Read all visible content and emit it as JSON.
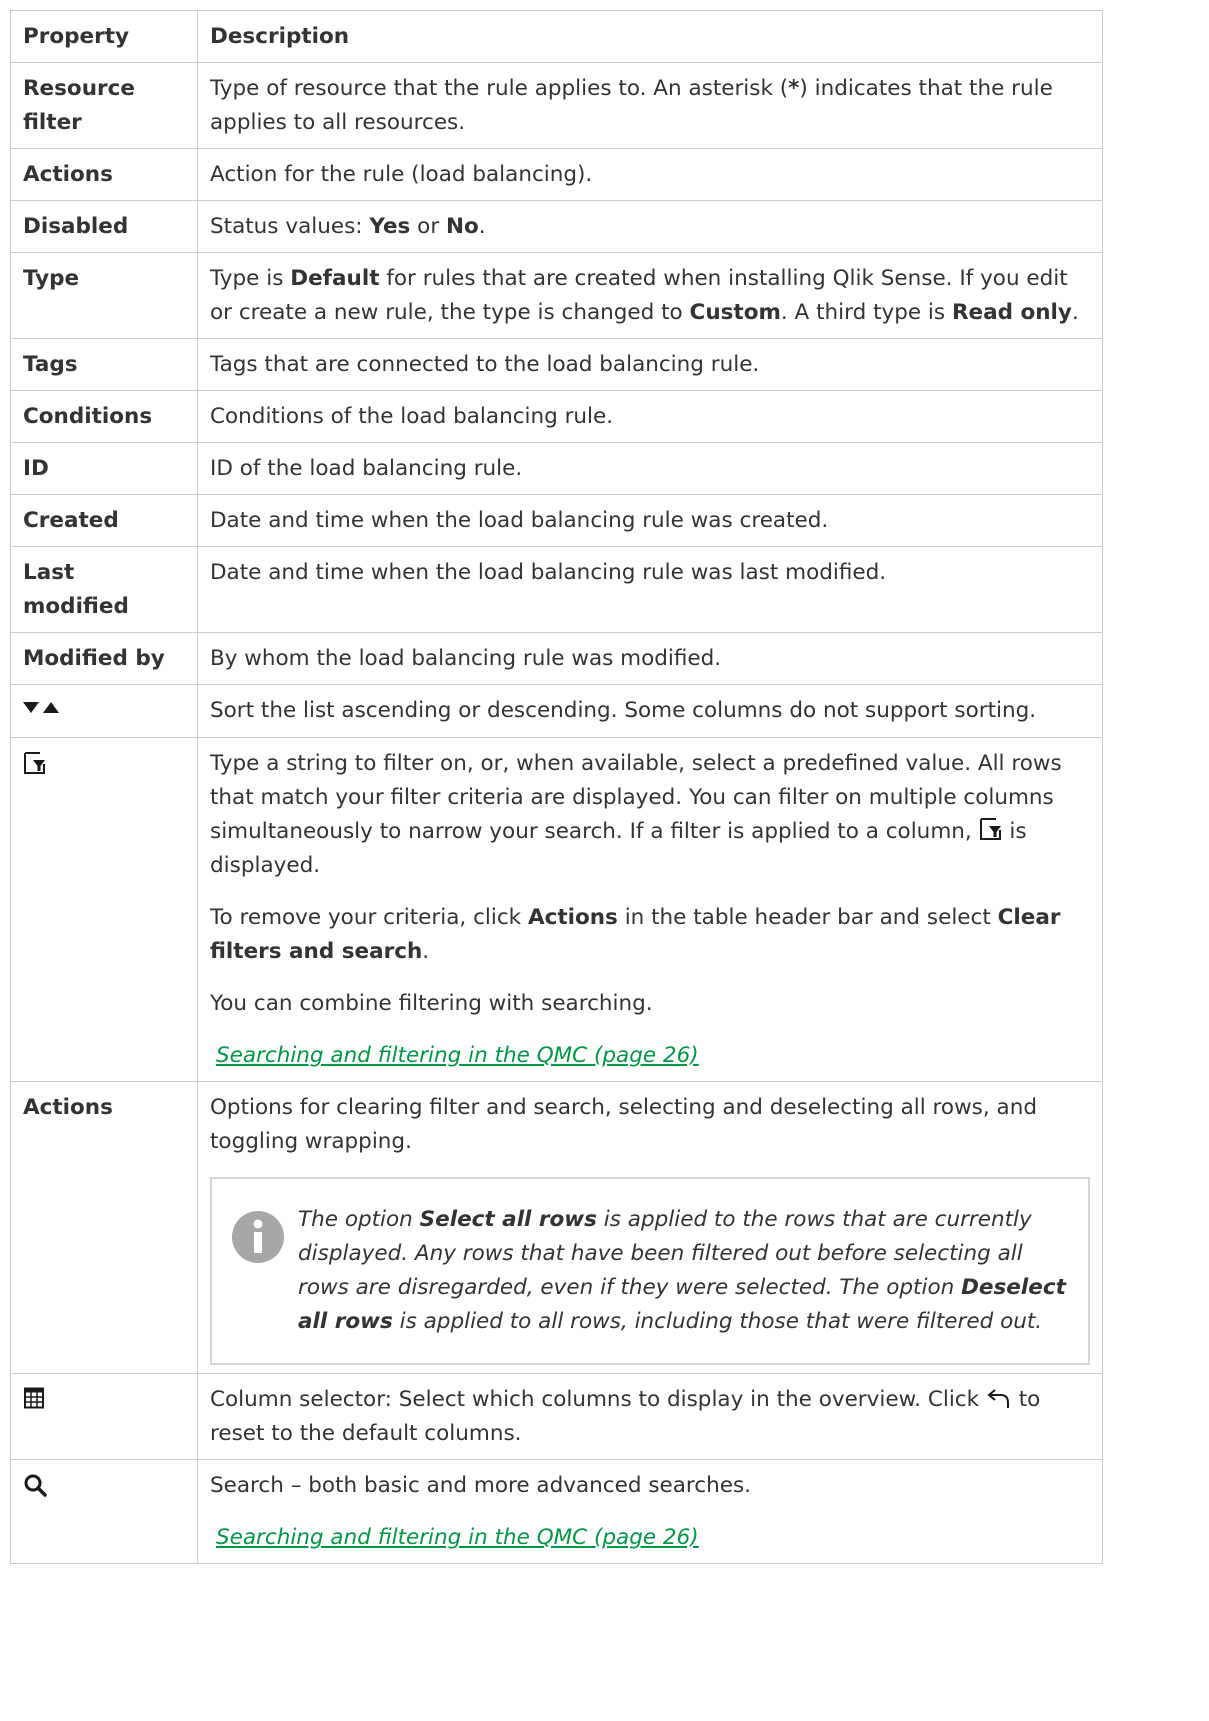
{
  "headers": {
    "property": "Property",
    "description": "Description"
  },
  "rows": {
    "resource_filter": {
      "property": "Resource filter",
      "d1": "Type of resource that the rule applies to. An asterisk (",
      "d2": "*",
      "d3": ") indicates that the rule applies to all resources."
    },
    "actions": {
      "property": "Actions",
      "description": "Action for the rule (load balancing)."
    },
    "disabled": {
      "property": "Disabled",
      "d1": "Status values: ",
      "d2": "Yes",
      "d3": " or ",
      "d4": "No",
      "d5": "."
    },
    "type": {
      "property": "Type",
      "d1": "Type is ",
      "d2": "Default",
      "d3": " for rules that are created when installing Qlik Sense. If you edit or create a new rule, the type is changed to ",
      "d4": "Custom",
      "d5": ". A third type is ",
      "d6": "Read only",
      "d7": "."
    },
    "tags": {
      "property": "Tags",
      "description": "Tags that are connected to the load balancing rule."
    },
    "conditions": {
      "property": "Conditions",
      "description": "Conditions of the load balancing rule."
    },
    "id": {
      "property": "ID",
      "description": "ID of the load balancing rule."
    },
    "created": {
      "property": "Created",
      "description": "Date and time when the load balancing rule was created."
    },
    "last_modified": {
      "property": "Last modified",
      "description": "Date and time when the load balancing rule was last modified."
    },
    "modified_by": {
      "property": "Modified by",
      "description": "By whom the load balancing rule was modified."
    },
    "sort": {
      "icon": "sort-arrows-icon",
      "description": "Sort the list ascending or descending. Some columns do not support sorting."
    },
    "filter": {
      "icon": "filter-icon",
      "p1a": "Type a string to filter on, or, when available, select a predefined value. All rows that match your filter criteria are displayed. You can filter on multiple columns simultaneously to narrow your search. If a filter is applied to a column, ",
      "p1b": " is displayed.",
      "p2a": "To remove your criteria, click ",
      "p2b": "Actions",
      "p2c": " in the table header bar and select ",
      "p2d": "Clear filters and search",
      "p2e": ".",
      "p3": "You can combine filtering with searching.",
      "link": "Searching and filtering in the QMC (page 26)"
    },
    "actions2": {
      "property": "Actions",
      "description": "Options for clearing filter and search, selecting and deselecting all rows, and toggling wrapping.",
      "note": {
        "icon": "info-icon",
        "n1": "The option ",
        "n2": "Select all rows",
        "n3": " is applied to the rows that are currently displayed. Any rows that have been filtered out before selecting all rows are disregarded, even if they were selected. The option ",
        "n4": "Deselect all rows",
        "n5": " is applied to all rows, including those that were filtered out."
      }
    },
    "column_selector": {
      "icon": "column-selector-icon",
      "d1": "Column selector: Select which columns to display in the overview. Click ",
      "reset_icon": "reset-arrow-icon",
      "d2": " to reset to the default columns."
    },
    "search": {
      "icon": "search-icon",
      "description": "Search – both basic and more advanced searches.",
      "link": "Searching and filtering in the QMC (page 26)"
    }
  },
  "colors": {
    "link": "#009845",
    "border": "#cccccc",
    "text": "#333333",
    "icon": "#1a1a1a"
  }
}
